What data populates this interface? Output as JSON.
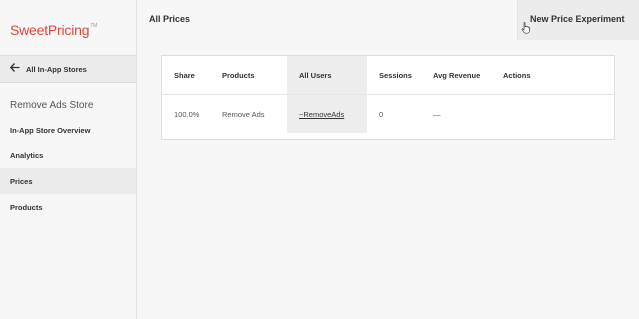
{
  "app": {
    "logo_sweet": "Sweet",
    "logo_pricing": "Pricing",
    "logo_tm": "TM"
  },
  "sidebar": {
    "back_label": "All In-App Stores",
    "store_name": "Remove Ads Store",
    "items": [
      {
        "label": "In-App Store Overview"
      },
      {
        "label": "Analytics"
      },
      {
        "label": "Prices"
      },
      {
        "label": "Products"
      }
    ],
    "active_item": "Prices"
  },
  "header": {
    "title": "All Prices",
    "new_button": "New Price Experiment"
  },
  "table": {
    "headers": {
      "share": "Share",
      "products": "Products",
      "all_users": "All Users",
      "sessions": "Sessions",
      "avg_revenue": "Avg Revenue",
      "actions": "Actions"
    },
    "rows": [
      {
        "share": "100.0%",
        "products": "Remove Ads",
        "all_users": "~RemoveAds",
        "sessions": "0",
        "avg_revenue": "—",
        "actions": ""
      }
    ]
  },
  "colors": {
    "brand_red": "#e0453a",
    "active_bg": "#ebebeb",
    "background": "#f7f7f7"
  }
}
